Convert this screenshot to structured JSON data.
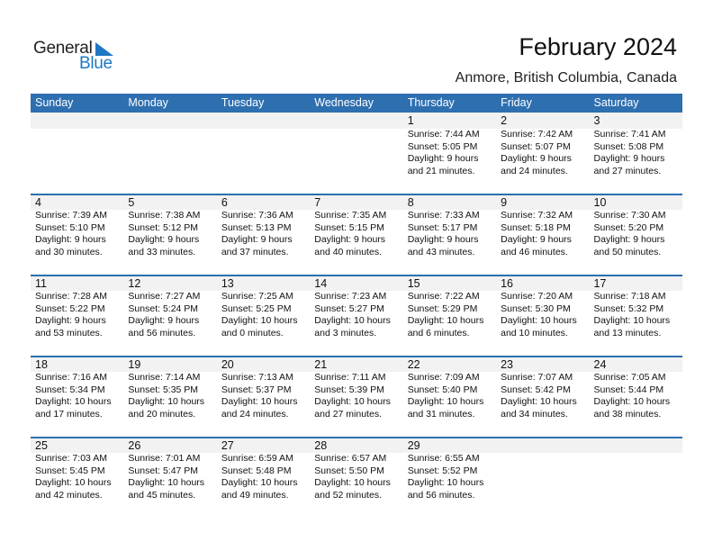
{
  "logo": {
    "general": "General",
    "blue": "Blue",
    "accent_color": "#1f78c4"
  },
  "header": {
    "title": "February 2024",
    "location": "Anmore, British Columbia, Canada"
  },
  "colors": {
    "header_bar": "#2e6fb0",
    "date_strip": "#f2f2f2"
  },
  "weekdays": [
    "Sunday",
    "Monday",
    "Tuesday",
    "Wednesday",
    "Thursday",
    "Friday",
    "Saturday"
  ],
  "weeks": [
    [
      null,
      null,
      null,
      null,
      {
        "day": "1",
        "sunrise": "Sunrise: 7:44 AM",
        "sunset": "Sunset: 5:05 PM",
        "daylight1": "Daylight: 9 hours",
        "daylight2": "and 21 minutes."
      },
      {
        "day": "2",
        "sunrise": "Sunrise: 7:42 AM",
        "sunset": "Sunset: 5:07 PM",
        "daylight1": "Daylight: 9 hours",
        "daylight2": "and 24 minutes."
      },
      {
        "day": "3",
        "sunrise": "Sunrise: 7:41 AM",
        "sunset": "Sunset: 5:08 PM",
        "daylight1": "Daylight: 9 hours",
        "daylight2": "and 27 minutes."
      }
    ],
    [
      {
        "day": "4",
        "sunrise": "Sunrise: 7:39 AM",
        "sunset": "Sunset: 5:10 PM",
        "daylight1": "Daylight: 9 hours",
        "daylight2": "and 30 minutes."
      },
      {
        "day": "5",
        "sunrise": "Sunrise: 7:38 AM",
        "sunset": "Sunset: 5:12 PM",
        "daylight1": "Daylight: 9 hours",
        "daylight2": "and 33 minutes."
      },
      {
        "day": "6",
        "sunrise": "Sunrise: 7:36 AM",
        "sunset": "Sunset: 5:13 PM",
        "daylight1": "Daylight: 9 hours",
        "daylight2": "and 37 minutes."
      },
      {
        "day": "7",
        "sunrise": "Sunrise: 7:35 AM",
        "sunset": "Sunset: 5:15 PM",
        "daylight1": "Daylight: 9 hours",
        "daylight2": "and 40 minutes."
      },
      {
        "day": "8",
        "sunrise": "Sunrise: 7:33 AM",
        "sunset": "Sunset: 5:17 PM",
        "daylight1": "Daylight: 9 hours",
        "daylight2": "and 43 minutes."
      },
      {
        "day": "9",
        "sunrise": "Sunrise: 7:32 AM",
        "sunset": "Sunset: 5:18 PM",
        "daylight1": "Daylight: 9 hours",
        "daylight2": "and 46 minutes."
      },
      {
        "day": "10",
        "sunrise": "Sunrise: 7:30 AM",
        "sunset": "Sunset: 5:20 PM",
        "daylight1": "Daylight: 9 hours",
        "daylight2": "and 50 minutes."
      }
    ],
    [
      {
        "day": "11",
        "sunrise": "Sunrise: 7:28 AM",
        "sunset": "Sunset: 5:22 PM",
        "daylight1": "Daylight: 9 hours",
        "daylight2": "and 53 minutes."
      },
      {
        "day": "12",
        "sunrise": "Sunrise: 7:27 AM",
        "sunset": "Sunset: 5:24 PM",
        "daylight1": "Daylight: 9 hours",
        "daylight2": "and 56 minutes."
      },
      {
        "day": "13",
        "sunrise": "Sunrise: 7:25 AM",
        "sunset": "Sunset: 5:25 PM",
        "daylight1": "Daylight: 10 hours",
        "daylight2": "and 0 minutes."
      },
      {
        "day": "14",
        "sunrise": "Sunrise: 7:23 AM",
        "sunset": "Sunset: 5:27 PM",
        "daylight1": "Daylight: 10 hours",
        "daylight2": "and 3 minutes."
      },
      {
        "day": "15",
        "sunrise": "Sunrise: 7:22 AM",
        "sunset": "Sunset: 5:29 PM",
        "daylight1": "Daylight: 10 hours",
        "daylight2": "and 6 minutes."
      },
      {
        "day": "16",
        "sunrise": "Sunrise: 7:20 AM",
        "sunset": "Sunset: 5:30 PM",
        "daylight1": "Daylight: 10 hours",
        "daylight2": "and 10 minutes."
      },
      {
        "day": "17",
        "sunrise": "Sunrise: 7:18 AM",
        "sunset": "Sunset: 5:32 PM",
        "daylight1": "Daylight: 10 hours",
        "daylight2": "and 13 minutes."
      }
    ],
    [
      {
        "day": "18",
        "sunrise": "Sunrise: 7:16 AM",
        "sunset": "Sunset: 5:34 PM",
        "daylight1": "Daylight: 10 hours",
        "daylight2": "and 17 minutes."
      },
      {
        "day": "19",
        "sunrise": "Sunrise: 7:14 AM",
        "sunset": "Sunset: 5:35 PM",
        "daylight1": "Daylight: 10 hours",
        "daylight2": "and 20 minutes."
      },
      {
        "day": "20",
        "sunrise": "Sunrise: 7:13 AM",
        "sunset": "Sunset: 5:37 PM",
        "daylight1": "Daylight: 10 hours",
        "daylight2": "and 24 minutes."
      },
      {
        "day": "21",
        "sunrise": "Sunrise: 7:11 AM",
        "sunset": "Sunset: 5:39 PM",
        "daylight1": "Daylight: 10 hours",
        "daylight2": "and 27 minutes."
      },
      {
        "day": "22",
        "sunrise": "Sunrise: 7:09 AM",
        "sunset": "Sunset: 5:40 PM",
        "daylight1": "Daylight: 10 hours",
        "daylight2": "and 31 minutes."
      },
      {
        "day": "23",
        "sunrise": "Sunrise: 7:07 AM",
        "sunset": "Sunset: 5:42 PM",
        "daylight1": "Daylight: 10 hours",
        "daylight2": "and 34 minutes."
      },
      {
        "day": "24",
        "sunrise": "Sunrise: 7:05 AM",
        "sunset": "Sunset: 5:44 PM",
        "daylight1": "Daylight: 10 hours",
        "daylight2": "and 38 minutes."
      }
    ],
    [
      {
        "day": "25",
        "sunrise": "Sunrise: 7:03 AM",
        "sunset": "Sunset: 5:45 PM",
        "daylight1": "Daylight: 10 hours",
        "daylight2": "and 42 minutes."
      },
      {
        "day": "26",
        "sunrise": "Sunrise: 7:01 AM",
        "sunset": "Sunset: 5:47 PM",
        "daylight1": "Daylight: 10 hours",
        "daylight2": "and 45 minutes."
      },
      {
        "day": "27",
        "sunrise": "Sunrise: 6:59 AM",
        "sunset": "Sunset: 5:48 PM",
        "daylight1": "Daylight: 10 hours",
        "daylight2": "and 49 minutes."
      },
      {
        "day": "28",
        "sunrise": "Sunrise: 6:57 AM",
        "sunset": "Sunset: 5:50 PM",
        "daylight1": "Daylight: 10 hours",
        "daylight2": "and 52 minutes."
      },
      {
        "day": "29",
        "sunrise": "Sunrise: 6:55 AM",
        "sunset": "Sunset: 5:52 PM",
        "daylight1": "Daylight: 10 hours",
        "daylight2": "and 56 minutes."
      },
      null,
      null
    ]
  ]
}
